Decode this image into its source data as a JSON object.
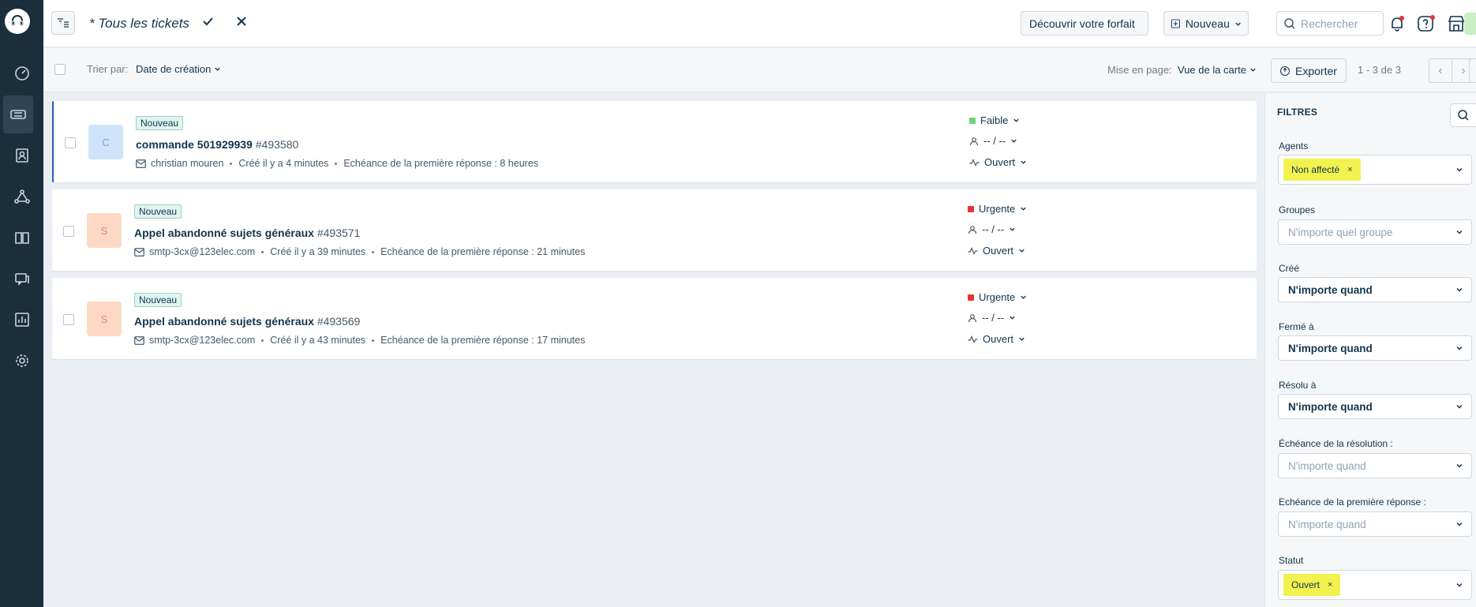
{
  "nav": {
    "items": [
      "dashboard-icon",
      "tickets-icon",
      "contacts-icon",
      "social-icon",
      "knowledge-base-icon",
      "chat-icon",
      "reports-icon",
      "settings-icon"
    ]
  },
  "header": {
    "view_title": "* Tous les tickets",
    "plan_button": "Découvrir votre forfait",
    "new_button": "Nouveau",
    "search_placeholder": "Rechercher"
  },
  "toolbar": {
    "sort_label": "Trier par:",
    "sort_value": "Date de création",
    "layout_label": "Mise en page:",
    "layout_value": "Vue de la carte",
    "export_label": "Exporter",
    "pagination": "1 - 3 de 3"
  },
  "tickets": [
    {
      "avatar": "C",
      "status_badge": "Nouveau",
      "subject": "commande 501929939",
      "number": "#493580",
      "requester": "christian mouren",
      "created": "Créé il y a 4 minutes",
      "due": "Echéance de la première réponse : 8 heures",
      "priority": "Faible",
      "assignee": "-- / --",
      "status": "Ouvert"
    },
    {
      "avatar": "S",
      "status_badge": "Nouveau",
      "subject": "Appel abandonné sujets généraux",
      "number": "#493571",
      "requester": "smtp-3cx@123elec.com",
      "created": "Créé il y a 39 minutes",
      "due": "Echéance de la première réponse : 21 minutes",
      "priority": "Urgente",
      "assignee": "-- / --",
      "status": "Ouvert"
    },
    {
      "avatar": "S",
      "status_badge": "Nouveau",
      "subject": "Appel abandonné sujets généraux",
      "number": "#493569",
      "requester": "smtp-3cx@123elec.com",
      "created": "Créé il y a 43 minutes",
      "due": "Echéance de la première réponse : 17 minutes",
      "priority": "Urgente",
      "assignee": "-- / --",
      "status": "Ouvert"
    }
  ],
  "filters": {
    "title": "FILTRES",
    "agents_label": "Agents",
    "agents_tag": "Non affecté",
    "groups_label": "Groupes",
    "groups_placeholder": "N'importe quel groupe",
    "created_label": "Créé",
    "created_value": "N'importe quand",
    "closed_label": "Fermé à",
    "closed_value": "N'importe quand",
    "resolved_label": "Résolu à",
    "resolved_value": "N'importe quand",
    "resolution_due_label": "Échéance de la résolution :",
    "resolution_due_placeholder": "N'importe quand",
    "first_response_due_label": "Echéance de la première réponse :",
    "first_response_due_placeholder": "N'importe quand",
    "status_label": "Statut",
    "status_tag": "Ouvert",
    "tag_remove": "×"
  },
  "colors": {
    "nav_bg": "#1b2e3c",
    "priority_low": "#6dd37d",
    "priority_urgent": "#e43538",
    "avatar_c_bg": "#cfe3fb",
    "avatar_s_bg": "#fdd9c5",
    "highlight": "#f2f24f"
  }
}
